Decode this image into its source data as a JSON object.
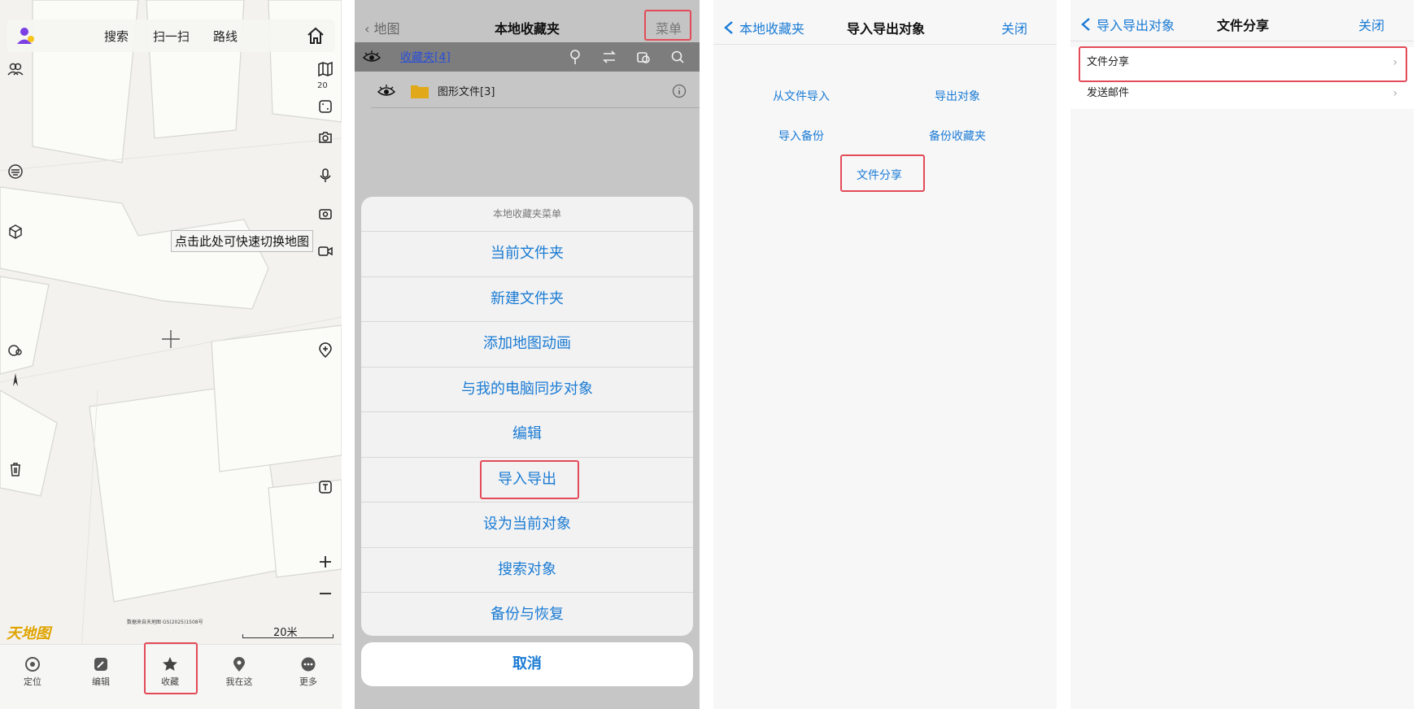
{
  "panel_map": {
    "top_tabs": [
      "搜索",
      "扫一扫",
      "路线"
    ],
    "zoom_level": "20",
    "tooltip": "点击此处可快速切换地图",
    "logo_text": "天地图",
    "attribution": "数据来自天地图 GS(2025)1508号",
    "scale_label": "20米",
    "bottom_nav": [
      {
        "label": "定位",
        "icon": "locate-icon"
      },
      {
        "label": "编辑",
        "icon": "edit-icon"
      },
      {
        "label": "收藏",
        "icon": "favorite-star-icon"
      },
      {
        "label": "我在这",
        "icon": "pin-icon"
      },
      {
        "label": "更多",
        "icon": "more-icon"
      }
    ]
  },
  "panel_favorites": {
    "back_label": "地图",
    "title": "本地收藏夹",
    "menu_label": "菜单",
    "folder_header": "收藏夹[4]",
    "folder_row": "图形文件[3]",
    "sheet": {
      "title": "本地收藏夹菜单",
      "items": [
        "当前文件夹",
        "新建文件夹",
        "添加地图动画",
        "与我的电脑同步对象",
        "编辑",
        "导入导出",
        "设为当前对象",
        "搜索对象",
        "备份与恢复"
      ],
      "cancel_label": "取消"
    }
  },
  "panel_import_export": {
    "back_label": "本地收藏夹",
    "title": "导入导出对象",
    "close_label": "关闭",
    "buttons": [
      "从文件导入",
      "导出对象",
      "导入备份",
      "备份收藏夹",
      "文件分享"
    ]
  },
  "panel_file_share": {
    "back_label": "导入导出对象",
    "title": "文件分享",
    "close_label": "关闭",
    "items": [
      "文件分享",
      "发送邮件"
    ]
  },
  "colors": {
    "accent_blue": "#1a7bd4",
    "highlight_red": "#e34b59",
    "link_blue": "#2b4fd8"
  }
}
